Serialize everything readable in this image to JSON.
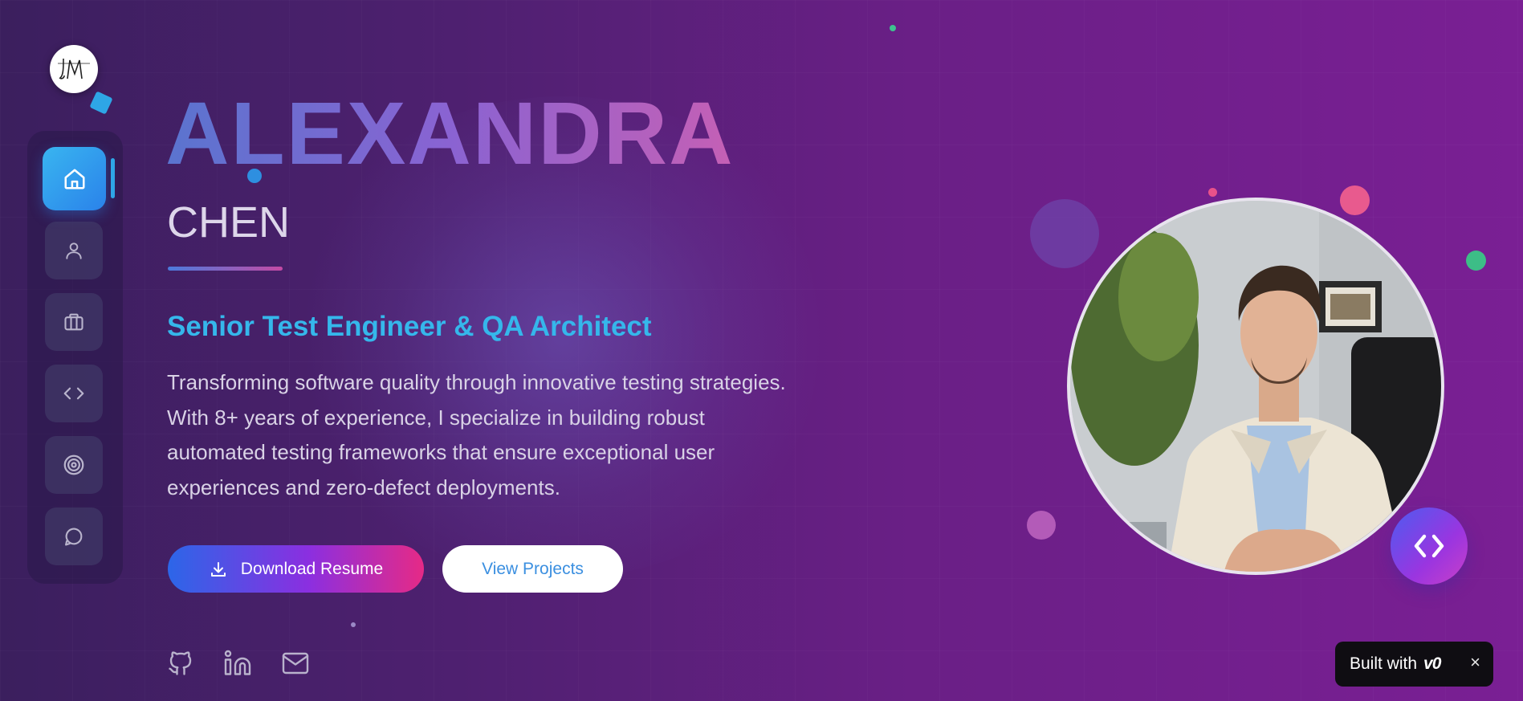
{
  "brand": {
    "logo_text": "JM"
  },
  "sidebar": {
    "items": [
      {
        "label": "Home",
        "icon": "home-icon",
        "active": true
      },
      {
        "label": "About",
        "icon": "user-icon",
        "active": false
      },
      {
        "label": "Experience",
        "icon": "briefcase-icon",
        "active": false
      },
      {
        "label": "Projects",
        "icon": "code-icon",
        "active": false
      },
      {
        "label": "Skills",
        "icon": "target-icon",
        "active": false
      },
      {
        "label": "Contact",
        "icon": "chat-icon",
        "active": false
      }
    ]
  },
  "hero": {
    "first_name": "ALEXANDRA",
    "last_name": "CHEN",
    "role": "Senior Test Engineer & QA Architect",
    "bio": "Transforming software quality through innovative testing strategies. With 8+ years of experience, I specialize in building robust automated testing frameworks that ensure exceptional user experiences and zero-defect deployments.",
    "primary_button": "Download Resume",
    "secondary_button": "View Projects"
  },
  "social": [
    "github-icon",
    "linkedin-icon",
    "mail-icon"
  ],
  "fab": {
    "icon": "code-icon"
  },
  "badge": {
    "text": "Built with",
    "brand": "v0",
    "close": "×"
  },
  "colors": {
    "accent_blue": "#35b7eb",
    "gradient_start": "#2c66e8",
    "gradient_end": "#e62a86",
    "background": "#6a1f86"
  }
}
